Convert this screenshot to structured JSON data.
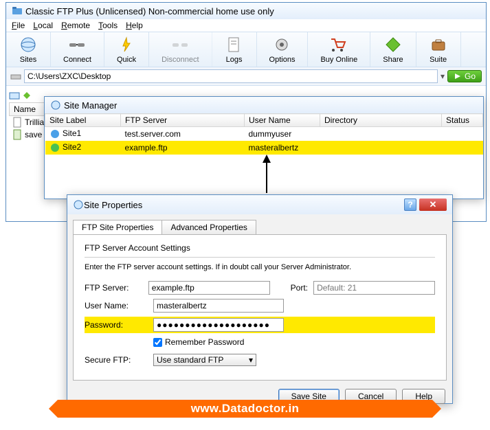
{
  "window": {
    "title": "Classic FTP Plus (Unlicensed) Non-commercial home use only"
  },
  "menubar": {
    "file": "File",
    "local": "Local",
    "remote": "Remote",
    "tools": "Tools",
    "help": "Help"
  },
  "toolbar": {
    "sites": "Sites",
    "connect": "Connect",
    "quick": "Quick",
    "disconnect": "Disconnect",
    "logs": "Logs",
    "options": "Options",
    "buyonline": "Buy Online",
    "share": "Share",
    "suite": "Suite"
  },
  "address": {
    "path": "C:\\Users\\ZXC\\Desktop",
    "go": "Go"
  },
  "local": {
    "name_header": "Name",
    "files": [
      "Trillia",
      "save i"
    ]
  },
  "site_manager": {
    "title": "Site Manager",
    "columns": {
      "label": "Site Label",
      "server": "FTP Server",
      "user": "User Name",
      "dir": "Directory",
      "status": "Status"
    },
    "rows": [
      {
        "label": "Site1",
        "server": "test.server.com",
        "user": "dummyuser",
        "dir": "",
        "status": ""
      },
      {
        "label": "Site2",
        "server": "example.ftp",
        "user": "masteralbertz",
        "dir": "",
        "status": ""
      }
    ],
    "selected": 1
  },
  "props": {
    "title": "Site Properties",
    "tabs": {
      "ftp": "FTP Site Properties",
      "adv": "Advanced Properties"
    },
    "section": "FTP Server Account Settings",
    "desc": "Enter the FTP server account settings. If in doubt call your Server Administrator.",
    "labels": {
      "server": "FTP Server:",
      "port": "Port:",
      "user": "User Name:",
      "password": "Password:",
      "remember": "Remember Password",
      "secure": "Secure FTP:"
    },
    "values": {
      "server": "example.ftp",
      "port_placeholder": "Default: 21",
      "user": "masteralbertz",
      "password": "●●●●●●●●●●●●●●●●●●●●",
      "remember_checked": true,
      "secure": "Use standard FTP"
    },
    "buttons": {
      "save": "Save Site",
      "cancel": "Cancel",
      "help": "Help"
    }
  },
  "banner": {
    "text": "www.Datadoctor.in"
  }
}
